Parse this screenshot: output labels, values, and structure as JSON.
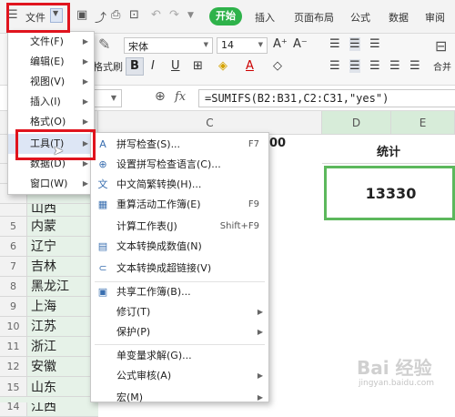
{
  "menubar": {
    "file_label": "文件",
    "start_label": "开始",
    "tabs": [
      "插入",
      "页面布局",
      "公式",
      "数据",
      "审阅"
    ]
  },
  "ribbon": {
    "font_name": "宋体",
    "font_size": "14",
    "format_painter_fragment": "格式刷",
    "merge_fragment": "合并"
  },
  "formula": {
    "fx": "fx",
    "content": "=SUMIFS(B2:B31,C2:C31,\"yes\")"
  },
  "columns": [
    "B",
    "C",
    "D",
    "E"
  ],
  "header_partial": "00",
  "stat_label": "统计",
  "stat_value": "13330",
  "rows": [
    {
      "num": "5",
      "b": "内蒙"
    },
    {
      "num": "6",
      "b": "辽宁"
    },
    {
      "num": "7",
      "b": "吉林"
    },
    {
      "num": "8",
      "b": "黑龙江"
    },
    {
      "num": "9",
      "b": "上海"
    },
    {
      "num": "10",
      "b": "江苏"
    },
    {
      "num": "11",
      "b": "浙江"
    },
    {
      "num": "12",
      "b": "安徽"
    },
    {
      "num": "13",
      "b": "福建"
    },
    {
      "num": "14",
      "b": "江西"
    },
    {
      "num": "15",
      "b": "山东"
    }
  ],
  "partial_row_text": "山西",
  "file_menu": [
    {
      "label": "文件(F)"
    },
    {
      "label": "编辑(E)"
    },
    {
      "label": "视图(V)"
    },
    {
      "label": "插入(I)"
    },
    {
      "label": "格式(O)"
    },
    {
      "label": "工具(T)"
    },
    {
      "label": "数据(D)"
    },
    {
      "label": "窗口(W)"
    }
  ],
  "tools_menu": [
    {
      "label": "拼写检查(S)...",
      "shortcut": "F7",
      "icon": "spellcheck-icon",
      "glyph": "A"
    },
    {
      "label": "设置拼写检查语言(C)...",
      "shortcut": "",
      "icon": "globe-icon",
      "glyph": "⊕"
    },
    {
      "label": "中文简繁转换(H)...",
      "shortcut": "",
      "icon": "convert-icon",
      "glyph": "文"
    },
    {
      "label": "重算活动工作簿(E)",
      "shortcut": "F9",
      "icon": "recalc-icon",
      "glyph": "▦"
    },
    {
      "label": "计算工作表(J)",
      "shortcut": "Shift+F9",
      "icon": "",
      "glyph": ""
    },
    {
      "label": "文本转换成数值(N)",
      "shortcut": "",
      "icon": "text-to-number-icon",
      "glyph": "▤"
    },
    {
      "label": "文本转换成超链接(V)",
      "shortcut": "",
      "icon": "link-icon",
      "glyph": "⊂"
    },
    {
      "label": "共享工作簿(B)...",
      "shortcut": "",
      "icon": "share-icon",
      "glyph": "▣"
    },
    {
      "label": "修订(T)",
      "shortcut": "",
      "icon": "",
      "glyph": ""
    },
    {
      "label": "保护(P)",
      "shortcut": "",
      "icon": "",
      "glyph": ""
    },
    {
      "label": "单变量求解(G)...",
      "shortcut": "",
      "icon": "",
      "glyph": ""
    },
    {
      "label": "公式审核(A)",
      "shortcut": "",
      "icon": "",
      "glyph": ""
    },
    {
      "label": "宏(M)",
      "shortcut": "",
      "icon": "",
      "glyph": ""
    }
  ],
  "watermark": "Bai 经验",
  "watermark_sub": "jingyan.baidu.com"
}
